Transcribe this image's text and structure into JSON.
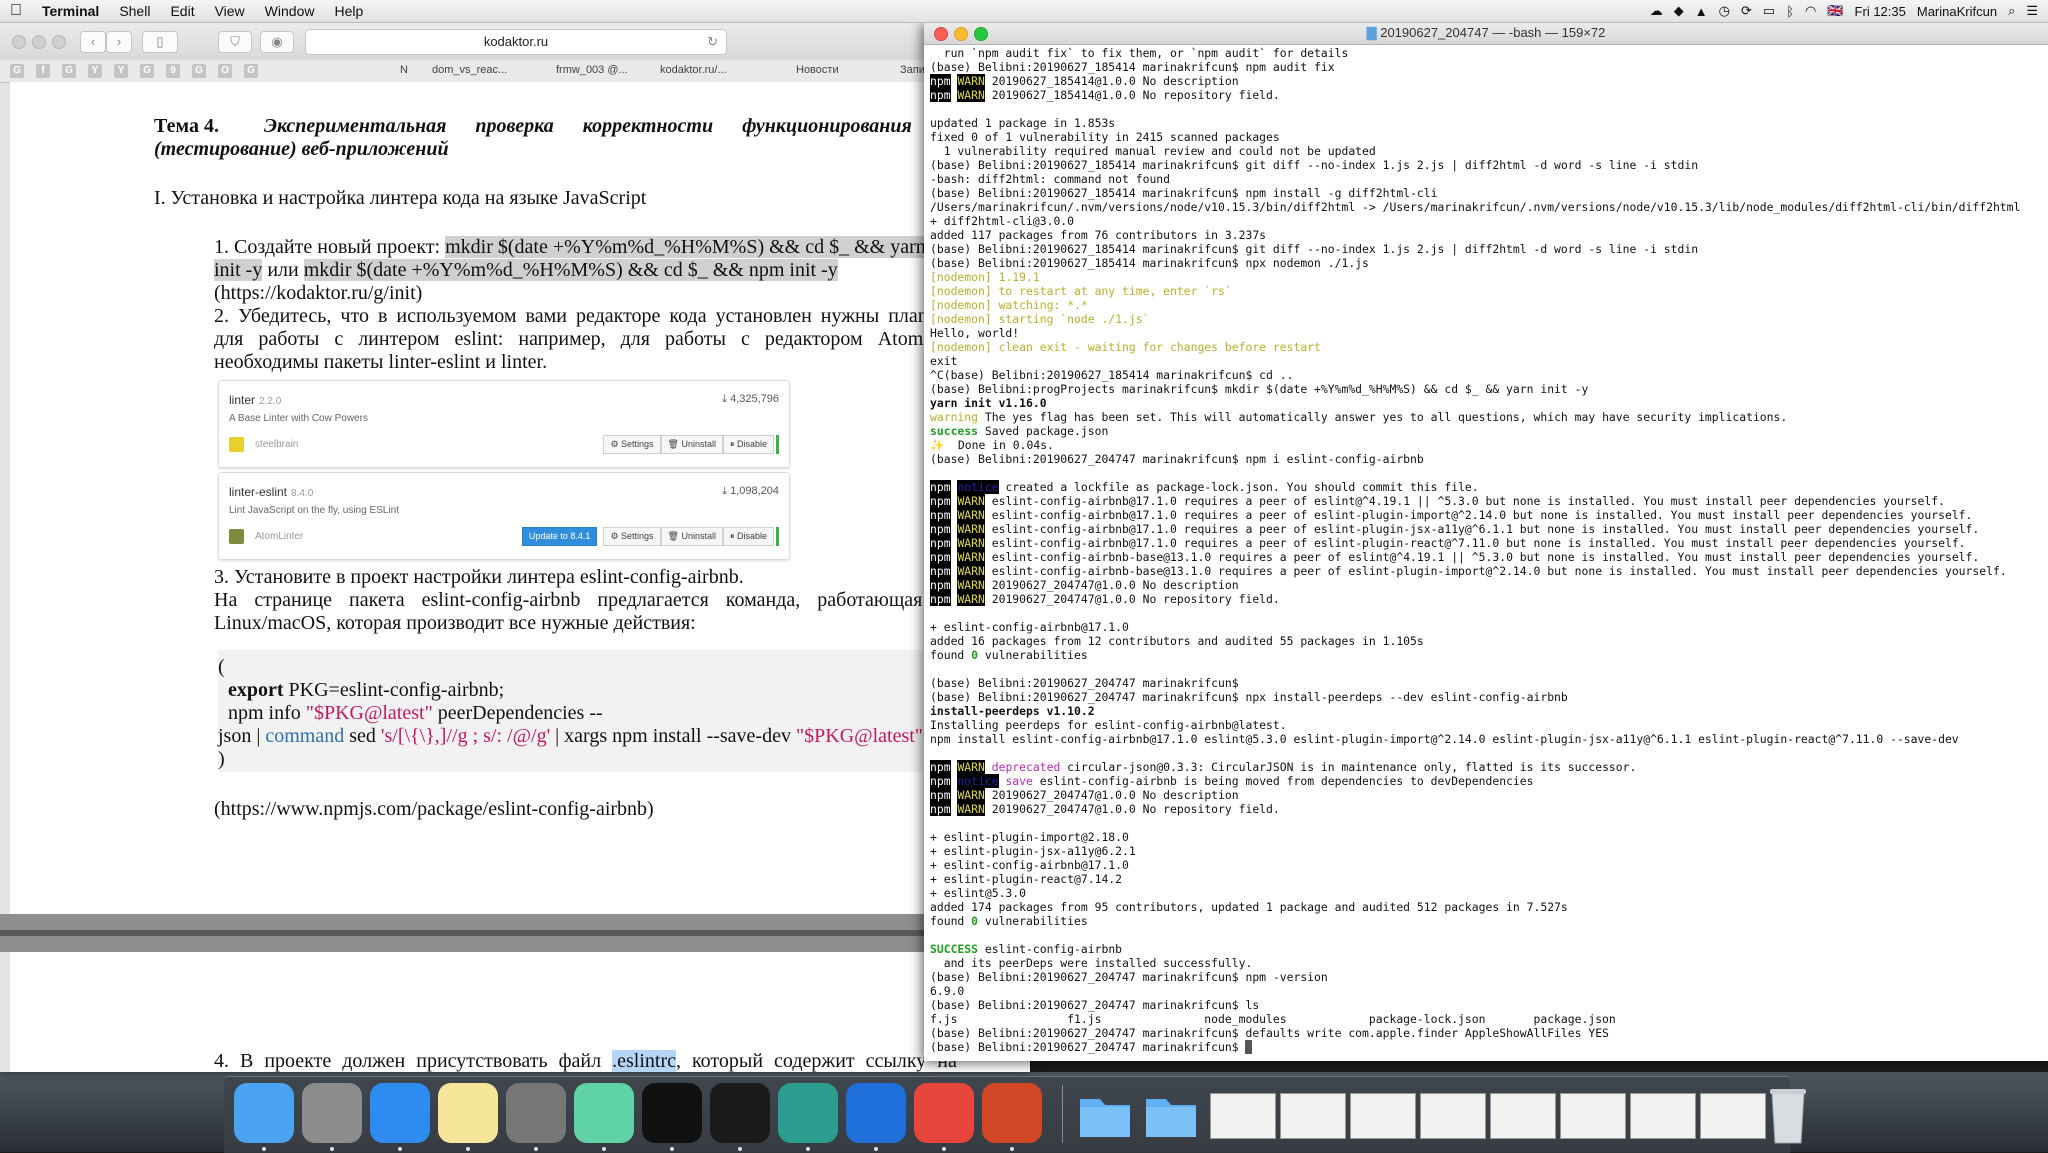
{
  "menubar": {
    "app": "Terminal",
    "items": [
      "Shell",
      "Edit",
      "View",
      "Window",
      "Help"
    ],
    "time": "Fri 12:35",
    "user": "MarinaKrifcun",
    "flag": "🇬🇧"
  },
  "safari": {
    "url": "kodaktor.ru",
    "tabs": [
      "N",
      "dom_vs_reac...",
      "frmw_003 @...",
      "kodaktor.ru/...",
      "Новости",
      "Запи"
    ],
    "bookmark_icons": [
      "G",
      "f",
      "G",
      "Y",
      "Y",
      "G",
      "9",
      "G",
      "O",
      "G"
    ]
  },
  "document": {
    "topic_label": "Тема 4.",
    "topic_title": "Экспериментальная проверка корректности функционирования",
    "topic_title2": "(тестирование) веб-приложений",
    "section1": "I. Установка и настройка линтера кода на языке JavaScript",
    "step1_a": "1. Создайте новый проект: ",
    "step1_cmd1": "mkdir $(date +%Y%m%d_%H%M%S) && cd $_ && yarn",
    "step1_b": "init -y",
    "step1_or": " или ",
    "step1_cmd2": "mkdir $(date +%Y%m%d_%H%M%S) && cd $_ && npm init -y",
    "step1_link": "(https://kodaktor.ru/g/init)",
    "step2_line1": "2. Убедитесь, что в используемом вами редакторе кода установлен нужны плагин",
    "step2_line2": "для работы с линтером eslint: например, для работы с редактором Atom",
    "step2_line3": "необходимы пакеты linter-eslint и linter.",
    "step3_line1": "3. Установите в проект настройки линтера  eslint-config-airbnb.",
    "step3_line2": "На странице пакета eslint-config-airbnb предлагается команда, работающая в",
    "step3_line3": "Linux/macOS, которая производит все нужные действия:",
    "code_open": "(",
    "code_export_kw": "export",
    "code_export_rest": " PKG=eslint-config-airbnb;",
    "code_npm": "npm info ",
    "code_pkg_str": "\"$PKG@latest\"",
    "code_peer": " peerDependencies --",
    "code_json": "json | ",
    "code_command": "command",
    "code_sed": " sed ",
    "code_sed_str": "'s/[\\{\\},]//g ; s/: /@/g'",
    "code_xargs": " | xargs npm install --save-dev ",
    "code_pkg2": "\"$PKG@latest\"",
    "code_close": ")",
    "npm_link": "(https://www.npmjs.com/package/eslint-config-airbnb)",
    "step4_a": "4. В проекте должен присутствовать файл ",
    "step4_file": ".eslintrc",
    "step4_b": ", который содержит ссылку на"
  },
  "atom_packages": [
    {
      "name": "linter",
      "version": "2.2.0",
      "description": "A Base Linter with Cow Powers",
      "author": "steelbrain",
      "downloads": "4,325,796",
      "buttons": [
        "⚙ Settings",
        "🗑 Uninstall",
        "⏸ Disable"
      ]
    },
    {
      "name": "linter-eslint",
      "version": "8.4.0",
      "description": "Lint JavaScript on the fly, using ESLint",
      "author": "AtomLinter",
      "downloads": "1,098,204",
      "update_button": "Update to 8.4.1",
      "buttons": [
        "⚙ Settings",
        "🗑 Uninstall",
        "⏸ Disable"
      ]
    }
  ],
  "terminal": {
    "title": "20190627_204747 — -bash — 159×72",
    "lines": [
      [
        {
          "t": "  run `npm audit fix` to fix them, or `npm audit` for details"
        }
      ],
      [
        {
          "t": "(base) Belibni:20190627_185414 marinakrifcun$ npm audit fix"
        }
      ],
      [
        {
          "t": "npm",
          "c": "npm"
        },
        {
          "t": " "
        },
        {
          "t": "WARN",
          "c": "warn"
        },
        {
          "t": " 20190627_185414@1.0.0 No description"
        }
      ],
      [
        {
          "t": "npm",
          "c": "npm"
        },
        {
          "t": " "
        },
        {
          "t": "WARN",
          "c": "warn"
        },
        {
          "t": " 20190627_185414@1.0.0 No repository field."
        }
      ],
      [
        {
          "t": ""
        }
      ],
      [
        {
          "t": "updated 1 package in 1.853s"
        }
      ],
      [
        {
          "t": "fixed 0 of 1 vulnerability in 2415 scanned packages"
        }
      ],
      [
        {
          "t": "  1 vulnerability required manual review and could not be updated"
        }
      ],
      [
        {
          "t": "(base) Belibni:20190627_185414 marinakrifcun$ git diff --no-index 1.js 2.js | diff2html -d word -s line -i stdin"
        }
      ],
      [
        {
          "t": "-bash: diff2html: command not found"
        }
      ],
      [
        {
          "t": "(base) Belibni:20190627_185414 marinakrifcun$ npm install -g diff2html-cli"
        }
      ],
      [
        {
          "t": "/Users/marinakrifcun/.nvm/versions/node/v10.15.3/bin/diff2html -> /Users/marinakrifcun/.nvm/versions/node/v10.15.3/lib/node_modules/diff2html-cli/bin/diff2html"
        }
      ],
      [
        {
          "t": "+ diff2html-cli@3.0.0"
        }
      ],
      [
        {
          "t": "added 117 packages from 76 contributors in 3.237s"
        }
      ],
      [
        {
          "t": "(base) Belibni:20190627_185414 marinakrifcun$ git diff --no-index 1.js 2.js | diff2html -d word -s line -i stdin"
        }
      ],
      [
        {
          "t": "(base) Belibni:20190627_185414 marinakrifcun$ npx nodemon ./1.js"
        }
      ],
      [
        {
          "t": "[nodemon] 1.19.1",
          "c": "grey"
        }
      ],
      [
        {
          "t": "[nodemon] to restart at any time, enter `rs`",
          "c": "grey"
        }
      ],
      [
        {
          "t": "[nodemon] watching: *.*",
          "c": "grey"
        }
      ],
      [
        {
          "t": "[nodemon] starting `node ./1.js`",
          "c": "grey"
        }
      ],
      [
        {
          "t": "Hello, world!"
        }
      ],
      [
        {
          "t": "[nodemon] clean exit - waiting for changes before restart",
          "c": "grey"
        }
      ],
      [
        {
          "t": "exit"
        }
      ],
      [
        {
          "t": "^C(base) Belibni:20190627_185414 marinakrifcun$ cd .."
        }
      ],
      [
        {
          "t": "(base) Belibni:progProjects marinakrifcun$ mkdir $(date +%Y%m%d_%H%M%S) && cd $_ && yarn init -y"
        }
      ],
      [
        {
          "t": "yarn init v1.16.0",
          "c": "bold"
        }
      ],
      [
        {
          "t": "warning",
          "c": "grey"
        },
        {
          "t": " The yes flag has been set. This will automatically answer yes to all questions, which may have security implications."
        }
      ],
      [
        {
          "t": "success",
          "c": "green"
        },
        {
          "t": " Saved package.json"
        }
      ],
      [
        {
          "t": "✨  Done in 0.04s."
        }
      ],
      [
        {
          "t": "(base) Belibni:20190627_204747 marinakrifcun$ npm i eslint-config-airbnb"
        }
      ],
      [
        {
          "t": ""
        }
      ],
      [
        {
          "t": "npm",
          "c": "npm"
        },
        {
          "t": " "
        },
        {
          "t": "notice",
          "c": "notice"
        },
        {
          "t": " created a lockfile as package-lock.json. You should commit this file."
        }
      ],
      [
        {
          "t": "npm",
          "c": "npm"
        },
        {
          "t": " "
        },
        {
          "t": "WARN",
          "c": "warn"
        },
        {
          "t": " eslint-config-airbnb@17.1.0 requires a peer of eslint@^4.19.1 || ^5.3.0 but none is installed. You must install peer dependencies yourself."
        }
      ],
      [
        {
          "t": "npm",
          "c": "npm"
        },
        {
          "t": " "
        },
        {
          "t": "WARN",
          "c": "warn"
        },
        {
          "t": " eslint-config-airbnb@17.1.0 requires a peer of eslint-plugin-import@^2.14.0 but none is installed. You must install peer dependencies yourself."
        }
      ],
      [
        {
          "t": "npm",
          "c": "npm"
        },
        {
          "t": " "
        },
        {
          "t": "WARN",
          "c": "warn"
        },
        {
          "t": " eslint-config-airbnb@17.1.0 requires a peer of eslint-plugin-jsx-a11y@^6.1.1 but none is installed. You must install peer dependencies yourself."
        }
      ],
      [
        {
          "t": "npm",
          "c": "npm"
        },
        {
          "t": " "
        },
        {
          "t": "WARN",
          "c": "warn"
        },
        {
          "t": " eslint-config-airbnb@17.1.0 requires a peer of eslint-plugin-react@^7.11.0 but none is installed. You must install peer dependencies yourself."
        }
      ],
      [
        {
          "t": "npm",
          "c": "npm"
        },
        {
          "t": " "
        },
        {
          "t": "WARN",
          "c": "warn"
        },
        {
          "t": " eslint-config-airbnb-base@13.1.0 requires a peer of eslint@^4.19.1 || ^5.3.0 but none is installed. You must install peer dependencies yourself."
        }
      ],
      [
        {
          "t": "npm",
          "c": "npm"
        },
        {
          "t": " "
        },
        {
          "t": "WARN",
          "c": "warn"
        },
        {
          "t": " eslint-config-airbnb-base@13.1.0 requires a peer of eslint-plugin-import@^2.14.0 but none is installed. You must install peer dependencies yourself."
        }
      ],
      [
        {
          "t": "npm",
          "c": "npm"
        },
        {
          "t": " "
        },
        {
          "t": "WARN",
          "c": "warn"
        },
        {
          "t": " 20190627_204747@1.0.0 No description"
        }
      ],
      [
        {
          "t": "npm",
          "c": "npm"
        },
        {
          "t": " "
        },
        {
          "t": "WARN",
          "c": "warn"
        },
        {
          "t": " 20190627_204747@1.0.0 No repository field."
        }
      ],
      [
        {
          "t": ""
        }
      ],
      [
        {
          "t": "+ eslint-config-airbnb@17.1.0"
        }
      ],
      [
        {
          "t": "added 16 packages from 12 contributors and audited 55 packages in 1.105s"
        }
      ],
      [
        {
          "t": "found "
        },
        {
          "t": "0",
          "c": "green"
        },
        {
          "t": " vulnerabilities"
        }
      ],
      [
        {
          "t": ""
        }
      ],
      [
        {
          "t": "(base) Belibni:20190627_204747 marinakrifcun$"
        }
      ],
      [
        {
          "t": "(base) Belibni:20190627_204747 marinakrifcun$ npx install-peerdeps --dev eslint-config-airbnb"
        }
      ],
      [
        {
          "t": "install-peerdeps v1.10.2",
          "c": "bold"
        }
      ],
      [
        {
          "t": "Installing peerdeps for eslint-config-airbnb@latest."
        }
      ],
      [
        {
          "t": "npm install eslint-config-airbnb@17.1.0 eslint@5.3.0 eslint-plugin-import@^2.14.0 eslint-plugin-jsx-a11y@^6.1.1 eslint-plugin-react@^7.11.0 --save-dev"
        }
      ],
      [
        {
          "t": ""
        }
      ],
      [
        {
          "t": "npm",
          "c": "npm"
        },
        {
          "t": " "
        },
        {
          "t": "WARN",
          "c": "warn"
        },
        {
          "t": " "
        },
        {
          "t": "deprecated",
          "c": "magenta"
        },
        {
          "t": " circular-json@0.3.3: CircularJSON is in maintenance only, flatted is its successor."
        }
      ],
      [
        {
          "t": "npm",
          "c": "npm"
        },
        {
          "t": " "
        },
        {
          "t": "notice",
          "c": "notice"
        },
        {
          "t": " "
        },
        {
          "t": "save",
          "c": "magenta"
        },
        {
          "t": " eslint-config-airbnb is being moved from dependencies to devDependencies"
        }
      ],
      [
        {
          "t": "npm",
          "c": "npm"
        },
        {
          "t": " "
        },
        {
          "t": "WARN",
          "c": "warn"
        },
        {
          "t": " 20190627_204747@1.0.0 No description"
        }
      ],
      [
        {
          "t": "npm",
          "c": "npm"
        },
        {
          "t": " "
        },
        {
          "t": "WARN",
          "c": "warn"
        },
        {
          "t": " 20190627_204747@1.0.0 No repository field."
        }
      ],
      [
        {
          "t": ""
        }
      ],
      [
        {
          "t": "+ eslint-plugin-import@2.18.0"
        }
      ],
      [
        {
          "t": "+ eslint-plugin-jsx-a11y@6.2.1"
        }
      ],
      [
        {
          "t": "+ eslint-config-airbnb@17.1.0"
        }
      ],
      [
        {
          "t": "+ eslint-plugin-react@7.14.2"
        }
      ],
      [
        {
          "t": "+ eslint@5.3.0"
        }
      ],
      [
        {
          "t": "added 174 packages from 95 contributors, updated 1 package and audited 512 packages in 7.527s"
        }
      ],
      [
        {
          "t": "found "
        },
        {
          "t": "0",
          "c": "green"
        },
        {
          "t": " vulnerabilities"
        }
      ],
      [
        {
          "t": ""
        }
      ],
      [
        {
          "t": "SUCCESS",
          "c": "green"
        },
        {
          "t": " eslint-config-airbnb"
        }
      ],
      [
        {
          "t": "  and its peerDeps were installed successfully."
        }
      ],
      [
        {
          "t": "(base) Belibni:20190627_204747 marinakrifcun$ npm -version"
        }
      ],
      [
        {
          "t": "6.9.0"
        }
      ],
      [
        {
          "t": "(base) Belibni:20190627_204747 marinakrifcun$ ls"
        }
      ],
      [
        {
          "t": "f.js                f1.js               node_modules            package-lock.json       package.json"
        }
      ],
      [
        {
          "t": "(base) Belibni:20190627_204747 marinakrifcun$ defaults write com.apple.finder AppleShowAllFiles YES"
        }
      ],
      [
        {
          "t": "(base) Belibni:20190627_204747 marinakrifcun$ "
        },
        {
          "t": " ",
          "c": "cursor"
        }
      ]
    ]
  },
  "dock": {
    "apps": [
      {
        "name": "finder-icon",
        "color": "#4aa3f0"
      },
      {
        "name": "launchpad-icon",
        "color": "#8c8c8c"
      },
      {
        "name": "safari-icon",
        "color": "#2e8cf0"
      },
      {
        "name": "notes-icon",
        "color": "#f6e69a"
      },
      {
        "name": "system-preferences-icon",
        "color": "#777"
      },
      {
        "name": "atom-icon",
        "color": "#5fd3a6"
      },
      {
        "name": "terminal-icon",
        "color": "#111"
      },
      {
        "name": "activity-monitor-icon",
        "color": "#1a1a1a"
      },
      {
        "name": "sketch-island-icon",
        "color": "#2a9d8f"
      },
      {
        "name": "app-blue-swoosh-icon",
        "color": "#1e6fd9"
      },
      {
        "name": "chrome-icon",
        "color": "#e8453c"
      },
      {
        "name": "powerpoint-icon",
        "color": "#d24726"
      }
    ]
  }
}
